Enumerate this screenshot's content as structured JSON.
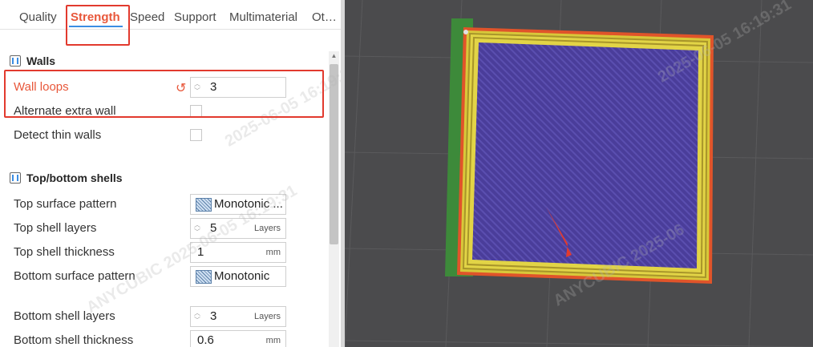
{
  "tabs": [
    {
      "label": "Quality"
    },
    {
      "label": "Strength"
    },
    {
      "label": "Speed"
    },
    {
      "label": "Support"
    },
    {
      "label": "Multimaterial"
    },
    {
      "label": "Ot…"
    }
  ],
  "walls": {
    "title": "Walls",
    "wall_loops": {
      "label": "Wall loops",
      "value": "3"
    },
    "alternate_extra_wall": {
      "label": "Alternate extra wall",
      "checked": false
    },
    "detect_thin_walls": {
      "label": "Detect thin walls",
      "checked": false
    }
  },
  "shells": {
    "title": "Top/bottom shells",
    "top_surface_pattern": {
      "label": "Top surface pattern",
      "value": "Monotonic ..."
    },
    "top_shell_layers": {
      "label": "Top shell layers",
      "value": "5",
      "unit": "Layers"
    },
    "top_shell_thickness": {
      "label": "Top shell thickness",
      "value": "1",
      "unit": "mm"
    },
    "bottom_surface_pattern": {
      "label": "Bottom surface pattern",
      "value": "Monotonic"
    },
    "bottom_shell_layers": {
      "label": "Bottom shell layers",
      "value": "3",
      "unit": "Layers"
    },
    "bottom_shell_thickness": {
      "label": "Bottom shell thickness",
      "value": "0.6",
      "unit": "mm"
    }
  },
  "watermarks": [
    "2025-06-05 16:19:31",
    "ANYCUBIC 2025-06-05 16:19:31",
    "ANYCUBIC 2025-06"
  ],
  "colors": {
    "accent": "#e8573a",
    "tab_underline": "#3b8de3",
    "highlight_box": "#e23a2e",
    "viewport_bg": "#4b4b4d",
    "skirt": "#3d8a3a",
    "outer_wall": "#e0542a",
    "inner_wall": "#d8c83a",
    "top_infill": "#4a3d9a"
  },
  "icons": {
    "reset": "reset-icon",
    "section": "section-icon",
    "pattern": "monotonic-pattern-icon",
    "arrow": "pointer-arrow"
  }
}
